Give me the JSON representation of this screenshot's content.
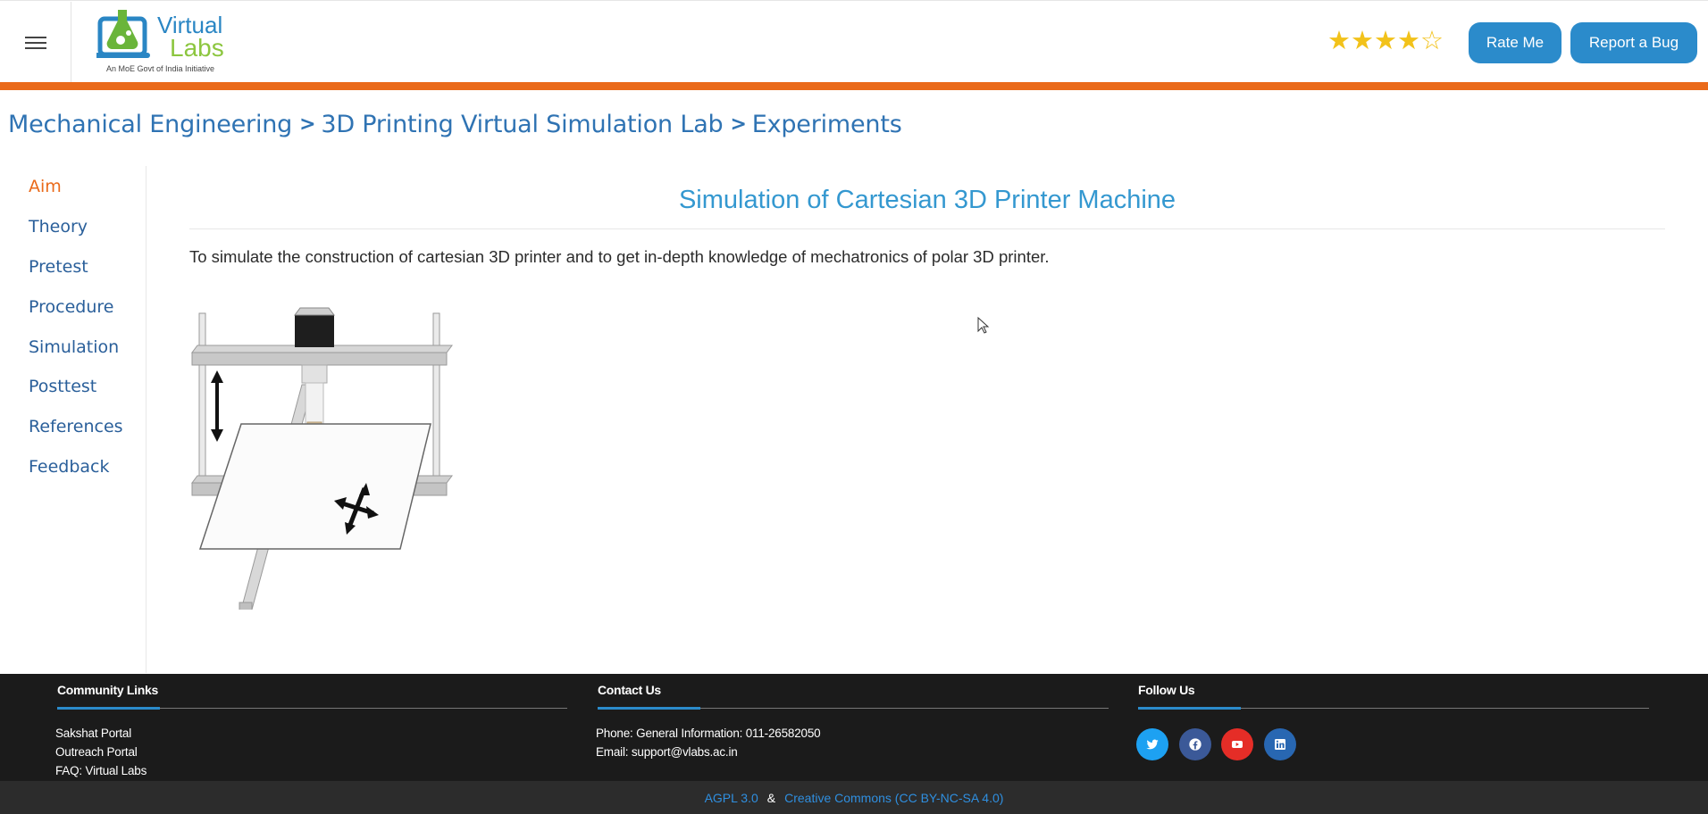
{
  "header": {
    "logo_title_1": "Virtual",
    "logo_title_2": "Labs",
    "logo_subtitle": "An MoE Govt of India Initiative",
    "rating": 4,
    "rating_max": 5,
    "rate_button": "Rate Me",
    "bug_button": "Report a Bug"
  },
  "breadcrumb": {
    "items": [
      "Mechanical Engineering",
      "3D Printing Virtual Simulation Lab",
      "Experiments"
    ]
  },
  "sidebar": {
    "items": [
      {
        "label": "Aim",
        "active": true
      },
      {
        "label": "Theory",
        "active": false
      },
      {
        "label": "Pretest",
        "active": false
      },
      {
        "label": "Procedure",
        "active": false
      },
      {
        "label": "Simulation",
        "active": false
      },
      {
        "label": "Posttest",
        "active": false
      },
      {
        "label": "References",
        "active": false
      },
      {
        "label": "Feedback",
        "active": false
      }
    ]
  },
  "main": {
    "title": "Simulation of Cartesian 3D Printer Machine",
    "aim_text": "To simulate the construction of cartesian 3D printer and to get in-depth knowledge of mechatronics of polar 3D printer."
  },
  "footer": {
    "community": {
      "heading": "Community Links",
      "links": [
        "Sakshat Portal",
        "Outreach Portal",
        "FAQ: Virtual Labs"
      ]
    },
    "contact": {
      "heading": "Contact Us",
      "phone": "Phone: General Information: 011-26582050",
      "email": "Email: support@vlabs.ac.in"
    },
    "follow": {
      "heading": "Follow Us",
      "icons": [
        "twitter-icon",
        "facebook-icon",
        "youtube-icon",
        "linkedin-icon"
      ]
    },
    "license_1": "AGPL 3.0",
    "license_sep": "&",
    "license_2": "Creative Commons (CC BY-NC-SA 4.0)"
  },
  "colors": {
    "accent_orange": "#ea6a1a",
    "primary_blue": "#2b8bcb",
    "title_blue": "#3498d0",
    "footer_bg": "#1b1b1b"
  }
}
